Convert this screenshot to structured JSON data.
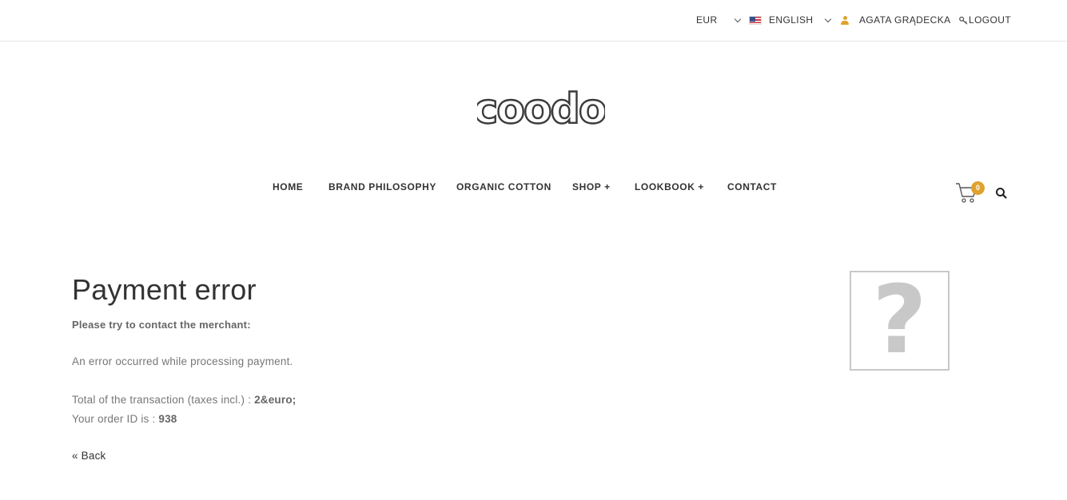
{
  "topbar": {
    "currency": "EUR",
    "language": "ENGLISH",
    "user_name": "AGATA GRĄDECKA",
    "logout_label": "LOGOUT"
  },
  "brand": {
    "logo_text": "coodo"
  },
  "nav": {
    "items": [
      {
        "label": "HOME"
      },
      {
        "label": "BRAND PHILOSOPHY"
      },
      {
        "label": "ORGANIC COTTON"
      },
      {
        "label": "SHOP +"
      },
      {
        "label": "LOOKBOOK +"
      },
      {
        "label": "CONTACT"
      }
    ]
  },
  "cart": {
    "count": "0"
  },
  "content": {
    "title": "Payment error",
    "subtitle": "Please try to contact the merchant:",
    "error_message": "An error occurred while processing payment.",
    "total_label": "Total of the transaction (taxes incl.) : ",
    "total_value": "2&euro;",
    "order_label": "Your order ID is : ",
    "order_value": "938",
    "back_label": "« Back"
  },
  "colors": {
    "accent": "#e0a22e",
    "text": "#333333",
    "muted": "#777777",
    "placeholder_gray": "#c8c8c8"
  },
  "icons": {
    "flag": "us-flag-icon",
    "user": "user-icon",
    "logout": "key-icon",
    "cart": "cart-icon",
    "search": "search-icon",
    "image": "missing-image-icon"
  }
}
